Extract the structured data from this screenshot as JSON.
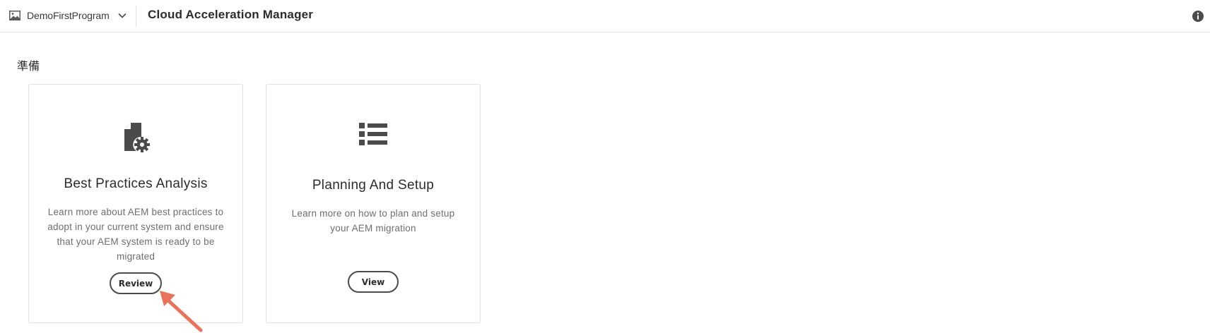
{
  "header": {
    "program_name": "DemoFirstProgram",
    "app_title": "Cloud Acceleration Manager",
    "icons": {
      "program": "image-icon",
      "switcher": "chevron-down-icon",
      "info": "info-icon"
    }
  },
  "section": {
    "heading": "準備"
  },
  "cards": [
    {
      "icon": "document-gear-icon",
      "title": "Best Practices Analysis",
      "description": "Learn more about AEM best practices to adopt in your current system and ensure that your AEM system is ready to be migrated",
      "button_label": "Review"
    },
    {
      "icon": "list-icon",
      "title": "Planning And Setup",
      "description": "Learn more on how to plan and setup your AEM migration",
      "button_label": "View"
    }
  ],
  "annotation": {
    "color": "#e8735a"
  },
  "colors": {
    "text": "#2c2c2c",
    "muted_text": "#6e6e6e",
    "border": "#e1e1e1",
    "icon": "#4b4b4b"
  }
}
